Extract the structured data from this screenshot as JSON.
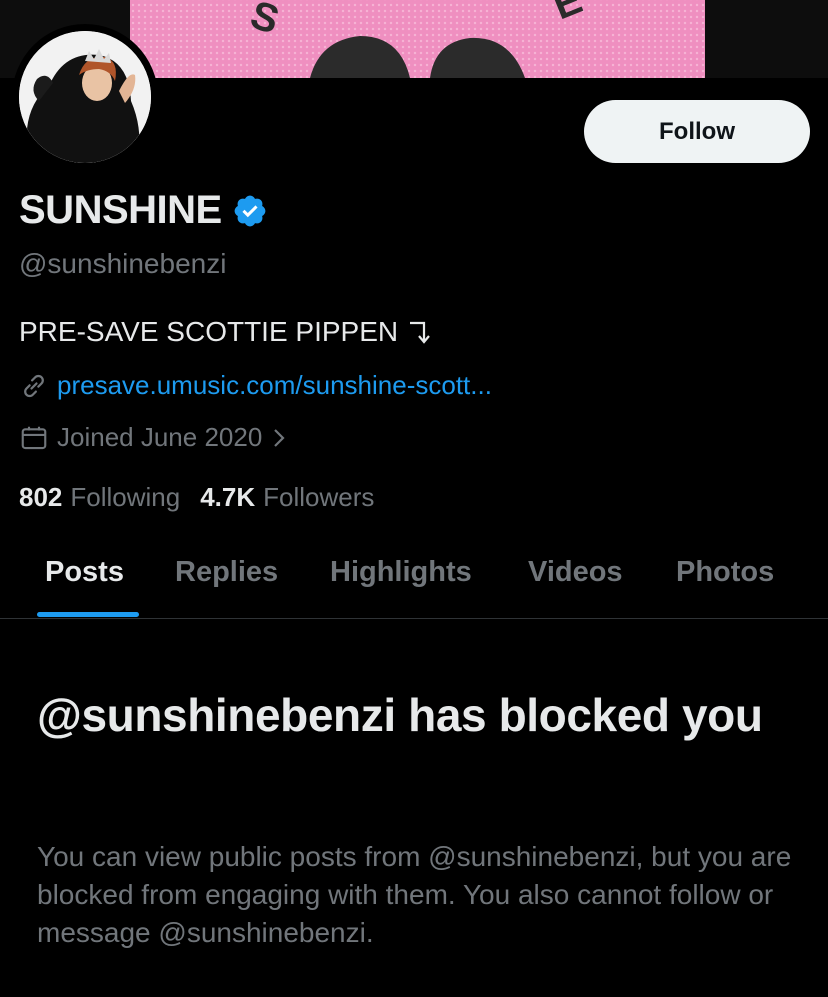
{
  "profile": {
    "name": "SUNSHINE",
    "handle": "@sunshinebenzi",
    "bio": "PRE-SAVE SCOTTIE PIPPEN",
    "link": "presave.umusic.com/sunshine-scott...",
    "joined": "Joined June 2020",
    "following_count": "802",
    "following_label": "Following",
    "followers_count": "4.7K",
    "followers_label": "Followers"
  },
  "actions": {
    "follow_label": "Follow"
  },
  "tabs": [
    {
      "label": "Posts",
      "active": true
    },
    {
      "label": "Replies"
    },
    {
      "label": "Highlights"
    },
    {
      "label": "Videos"
    },
    {
      "label": "Photos"
    }
  ],
  "blocked": {
    "title": "@sunshinebenzi has blocked you",
    "description": "You can view public posts from @sunshinebenzi, but you are blocked from engaging with them. You also cannot follow or message @sunshinebenzi."
  },
  "icons": {
    "verified": "verified-badge-icon",
    "link": "link-icon",
    "calendar": "calendar-icon",
    "chevron": "chevron-right-icon",
    "arrow": "down-right-arrow-icon"
  },
  "colors": {
    "background": "#000000",
    "text": "#e7e9ea",
    "muted": "#71767b",
    "accent": "#1d9bf0",
    "banner_pink": "#ef8fc0"
  }
}
